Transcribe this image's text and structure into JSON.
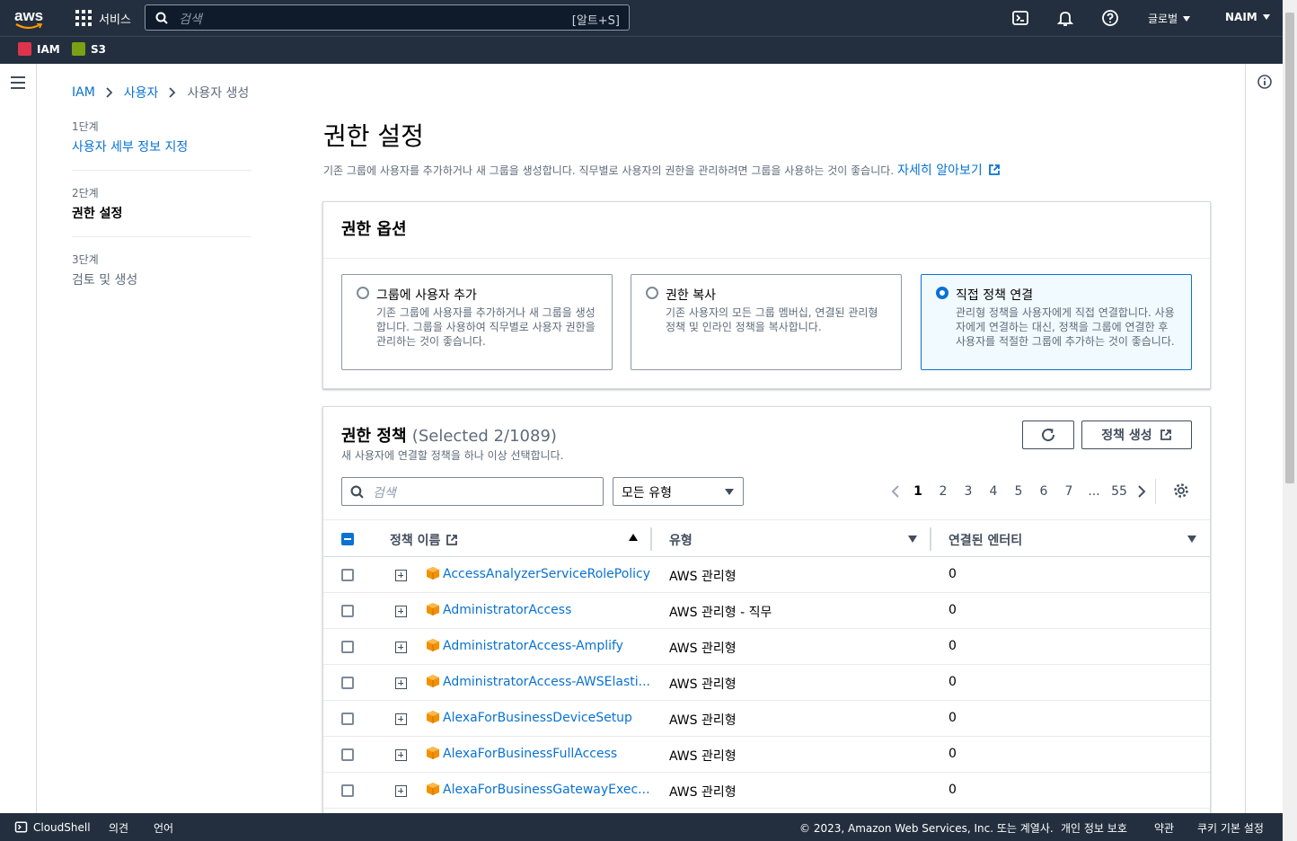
{
  "topbar": {
    "logo_text": "aws",
    "services_label": "서비스",
    "search_placeholder": "검색",
    "search_shortcut": "[알트+S]",
    "region_label": "글로벌",
    "user_label": "NAIM",
    "icons": [
      "cloudshell-icon",
      "bell-icon",
      "help-icon"
    ]
  },
  "favorites": [
    {
      "label": "IAM",
      "color": "#dd344c"
    },
    {
      "label": "S3",
      "color": "#7aa116"
    }
  ],
  "breadcrumb": [
    "IAM",
    "사용자",
    "사용자 생성"
  ],
  "steps": [
    {
      "num": "1단계",
      "name": "사용자 세부 정보 지정",
      "state": "link"
    },
    {
      "num": "2단계",
      "name": "권한 설정",
      "state": "active"
    },
    {
      "num": "3단계",
      "name": "검토 및 생성",
      "state": "disabled"
    }
  ],
  "page": {
    "title": "권한 설정",
    "description": "기존 그룹에 사용자를 추가하거나 새 그룹을 생성합니다. 직무별로 사용자의 권한을 관리하려면 그룹을 사용하는 것이 좋습니다.",
    "learn_more": "자세히 알아보기"
  },
  "permission_options": {
    "header": "권한 옵션",
    "options": [
      {
        "title": "그룹에 사용자 추가",
        "desc": "기존 그룹에 사용자를 추가하거나 새 그룹을 생성합니다. 그룹을 사용하여 직무별로 사용자 권한을 관리하는 것이 좋습니다.",
        "selected": false
      },
      {
        "title": "권한 복사",
        "desc": "기존 사용자의 모든 그룹 멤버십, 연결된 관리형 정책 및 인라인 정책을 복사합니다.",
        "selected": false
      },
      {
        "title": "직접 정책 연결",
        "desc": "관리형 정책을 사용자에게 직접 연결합니다. 사용자에게 연결하는 대신, 정책을 그룹에 연결한 후 사용자를 적절한 그룹에 추가하는 것이 좋습니다.",
        "selected": true
      }
    ]
  },
  "policies": {
    "title": "권한 정책",
    "count": "(Selected 2/1089)",
    "subtitle": "새 사용자에 연결할 정책을 하나 이상 선택합니다.",
    "create_button": "정책 생성",
    "filter_placeholder": "검색",
    "type_filter": "모든 유형",
    "pages": [
      "1",
      "2",
      "3",
      "4",
      "5",
      "6",
      "7",
      "...",
      "55"
    ],
    "current_page": "1",
    "columns": {
      "name": "정책 이름",
      "type": "유형",
      "entities": "연결된 엔터티"
    },
    "rows": [
      {
        "name": "AccessAnalyzerServiceRolePolicy",
        "type": "AWS 관리형",
        "entities": "0"
      },
      {
        "name": "AdministratorAccess",
        "type": "AWS 관리형 - 직무",
        "entities": "0"
      },
      {
        "name": "AdministratorAccess-Amplify",
        "type": "AWS 관리형",
        "entities": "0"
      },
      {
        "name": "AdministratorAccess-AWSElasti...",
        "type": "AWS 관리형",
        "entities": "0"
      },
      {
        "name": "AlexaForBusinessDeviceSetup",
        "type": "AWS 관리형",
        "entities": "0"
      },
      {
        "name": "AlexaForBusinessFullAccess",
        "type": "AWS 관리형",
        "entities": "0"
      },
      {
        "name": "AlexaForBusinessGatewayExec...",
        "type": "AWS 관리형",
        "entities": "0"
      }
    ]
  },
  "footer": {
    "cloudshell": "CloudShell",
    "feedback": "의견",
    "language": "언어",
    "copyright": "© 2023, Amazon Web Services, Inc. 또는 계열사.",
    "privacy": "개인 정보 보호",
    "terms": "약관",
    "cookies": "쿠키 기본 설정"
  }
}
